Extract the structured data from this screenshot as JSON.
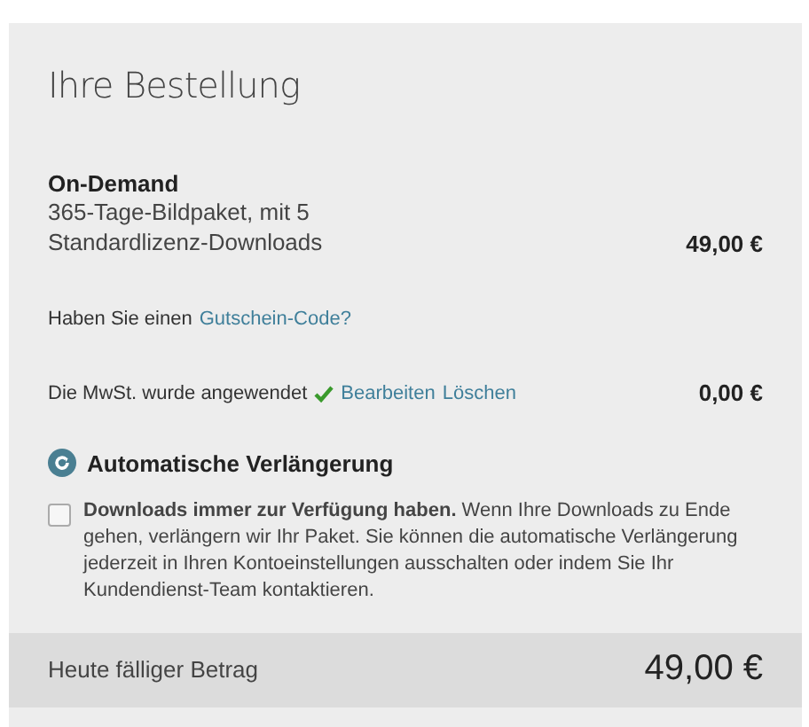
{
  "title": "Ihre Bestellung",
  "product": {
    "name": "On-Demand",
    "description": "365-Tage-Bildpaket, mit 5 Standardlizenz-Downloads",
    "price": "49,00 €"
  },
  "voucher": {
    "text": "Haben Sie einen",
    "link": "Gutschein-Code?"
  },
  "vat": {
    "text": "Die MwSt. wurde angewendet",
    "applied": true,
    "links": [
      "Bearbeiten",
      "Löschen"
    ],
    "amount": "0,00 €"
  },
  "renewal": {
    "title": "Automatische Verlängerung",
    "checked": false,
    "description": "**Downloads immer zur Verfügung haben.** Wenn Ihre Downloads zu Ende gehen, verlängern wir Ihr Paket. Sie können die automatische Verlängerung jederzeit in Ihren Kontoeinstellungen ausschalten oder indem Sie Ihr Kundendienst-Team kontaktieren."
  },
  "total": {
    "label": "Heute fälliger Betrag",
    "amount": "49,00 €"
  }
}
